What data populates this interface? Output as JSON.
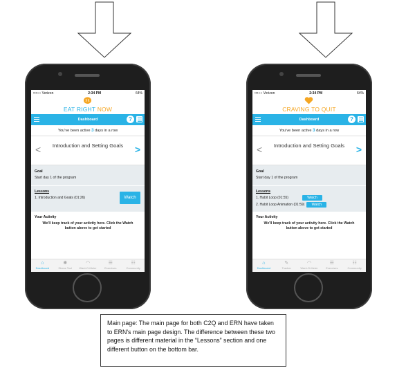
{
  "phones": [
    {
      "status": {
        "carrier": "•••○○ Verizon",
        "time": "2:34 PM",
        "battery": "64%"
      },
      "brand": {
        "first": "EAT RIGHT ",
        "accent": "NOW",
        "first_color": "#2ab3e6",
        "accent_color": "#f5a623"
      },
      "logo_icon": "brain-icon",
      "nav": {
        "title": "Dashboard",
        "help": "?"
      },
      "active": {
        "prefix": "You've been active ",
        "count": "3",
        "suffix": " days in a row"
      },
      "lesson_title": "Introduction and Setting Goals",
      "goal": {
        "heading": "Goal",
        "text": "Start day 1 of the program"
      },
      "lessons": {
        "heading": "Lessons",
        "items": [
          "1. Introduction and Goals (01:26)"
        ],
        "watch": "Watch"
      },
      "activity": {
        "heading": "Your Activity",
        "text": "We'll keep track of your activity here. Click the Watch button above to get started"
      },
      "tabs": [
        {
          "label": "Dashboard",
          "icon": "home-icon"
        },
        {
          "label": "Stress Tool",
          "icon": "stress-tool-icon"
        },
        {
          "label": "Want-O-Meter",
          "icon": "meter-icon"
        },
        {
          "label": "Exercises",
          "icon": "list-icon"
        },
        {
          "label": "Community",
          "icon": "community-icon"
        }
      ]
    },
    {
      "status": {
        "carrier": "•••○○ Verizon",
        "time": "2:34 PM",
        "battery": "64%"
      },
      "brand": {
        "first": "CRAVING ",
        "accent": "TO QUIT",
        "first_color": "#f5a623",
        "accent_color": "#f5a623"
      },
      "logo_icon": "heart-icon",
      "nav": {
        "title": "Dashboard",
        "help": "?"
      },
      "active": {
        "prefix": "You've been active ",
        "count": "3",
        "suffix": " days in a row"
      },
      "lesson_title": "Introduction and Setting Goals",
      "goal": {
        "heading": "Goal",
        "text": "Start day 1 of the program"
      },
      "lessons": {
        "heading": "Lessons",
        "items": [
          "1. Habit Loop (01:55)",
          "2. Habit Loop Animation (01:59)"
        ],
        "watch": "Watch"
      },
      "activity": {
        "heading": "Your Activity",
        "text": "We'll keep track of your activity here. Click the Watch button above to get started"
      },
      "tabs": [
        {
          "label": "Dashboard",
          "icon": "home-icon"
        },
        {
          "label": "Tracker",
          "icon": "tracker-icon"
        },
        {
          "label": "Want-O-Meter",
          "icon": "meter-icon"
        },
        {
          "label": "Exercises",
          "icon": "list-icon"
        },
        {
          "label": "Community",
          "icon": "community-icon"
        }
      ]
    }
  ],
  "caption": "Main page: The main page for both C2Q and ERN have taken to ERN's main page design. The difference between these two pages is different material in the “Lessons” section and one different button on the bottom bar.",
  "accent_color": "#2ab3e6"
}
